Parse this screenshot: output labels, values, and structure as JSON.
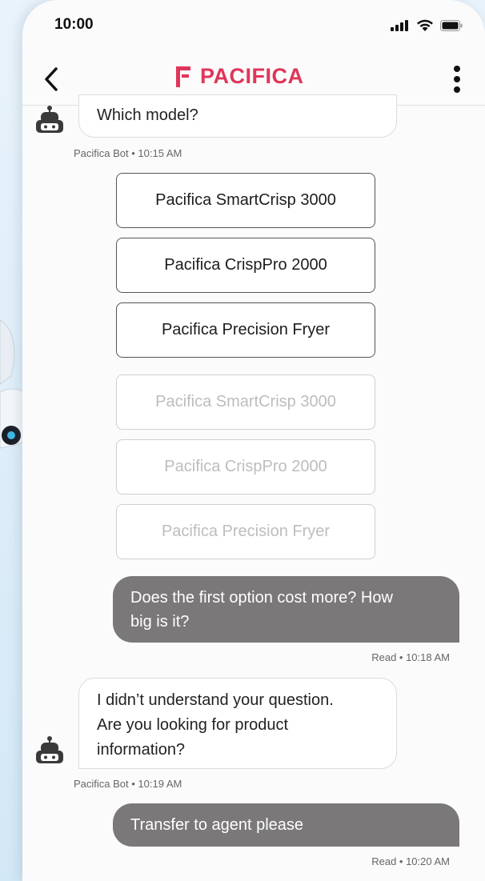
{
  "status_bar": {
    "time": "10:00"
  },
  "header": {
    "brand": "PACIFICA"
  },
  "messages": {
    "bot1_text": "Which model?",
    "bot1_meta": "Pacifica Bot • 10:15 AM",
    "options_active": [
      "Pacifica SmartCrisp 3000",
      "Pacifica CrispPro 2000",
      "Pacifica Precision Fryer"
    ],
    "options_disabled": [
      "Pacifica SmartCrisp 3000",
      "Pacifica CrispPro 2000",
      "Pacifica Precision Fryer"
    ],
    "user1_line1": "Does the first option cost more? How",
    "user1_line2": "big is it?",
    "user1_meta": "Read • 10:18 AM",
    "bot2_line1": "I didn’t understand your question.",
    "bot2_line2": "Are you looking for product",
    "bot2_line3": "information?",
    "bot2_meta": "Pacifica Bot • 10:19 AM",
    "user2_text": "Transfer to agent please",
    "user2_meta": "Read • 10:20 AM"
  },
  "colors": {
    "brand": "#e0355a",
    "user_bubble": "#7b7879"
  }
}
